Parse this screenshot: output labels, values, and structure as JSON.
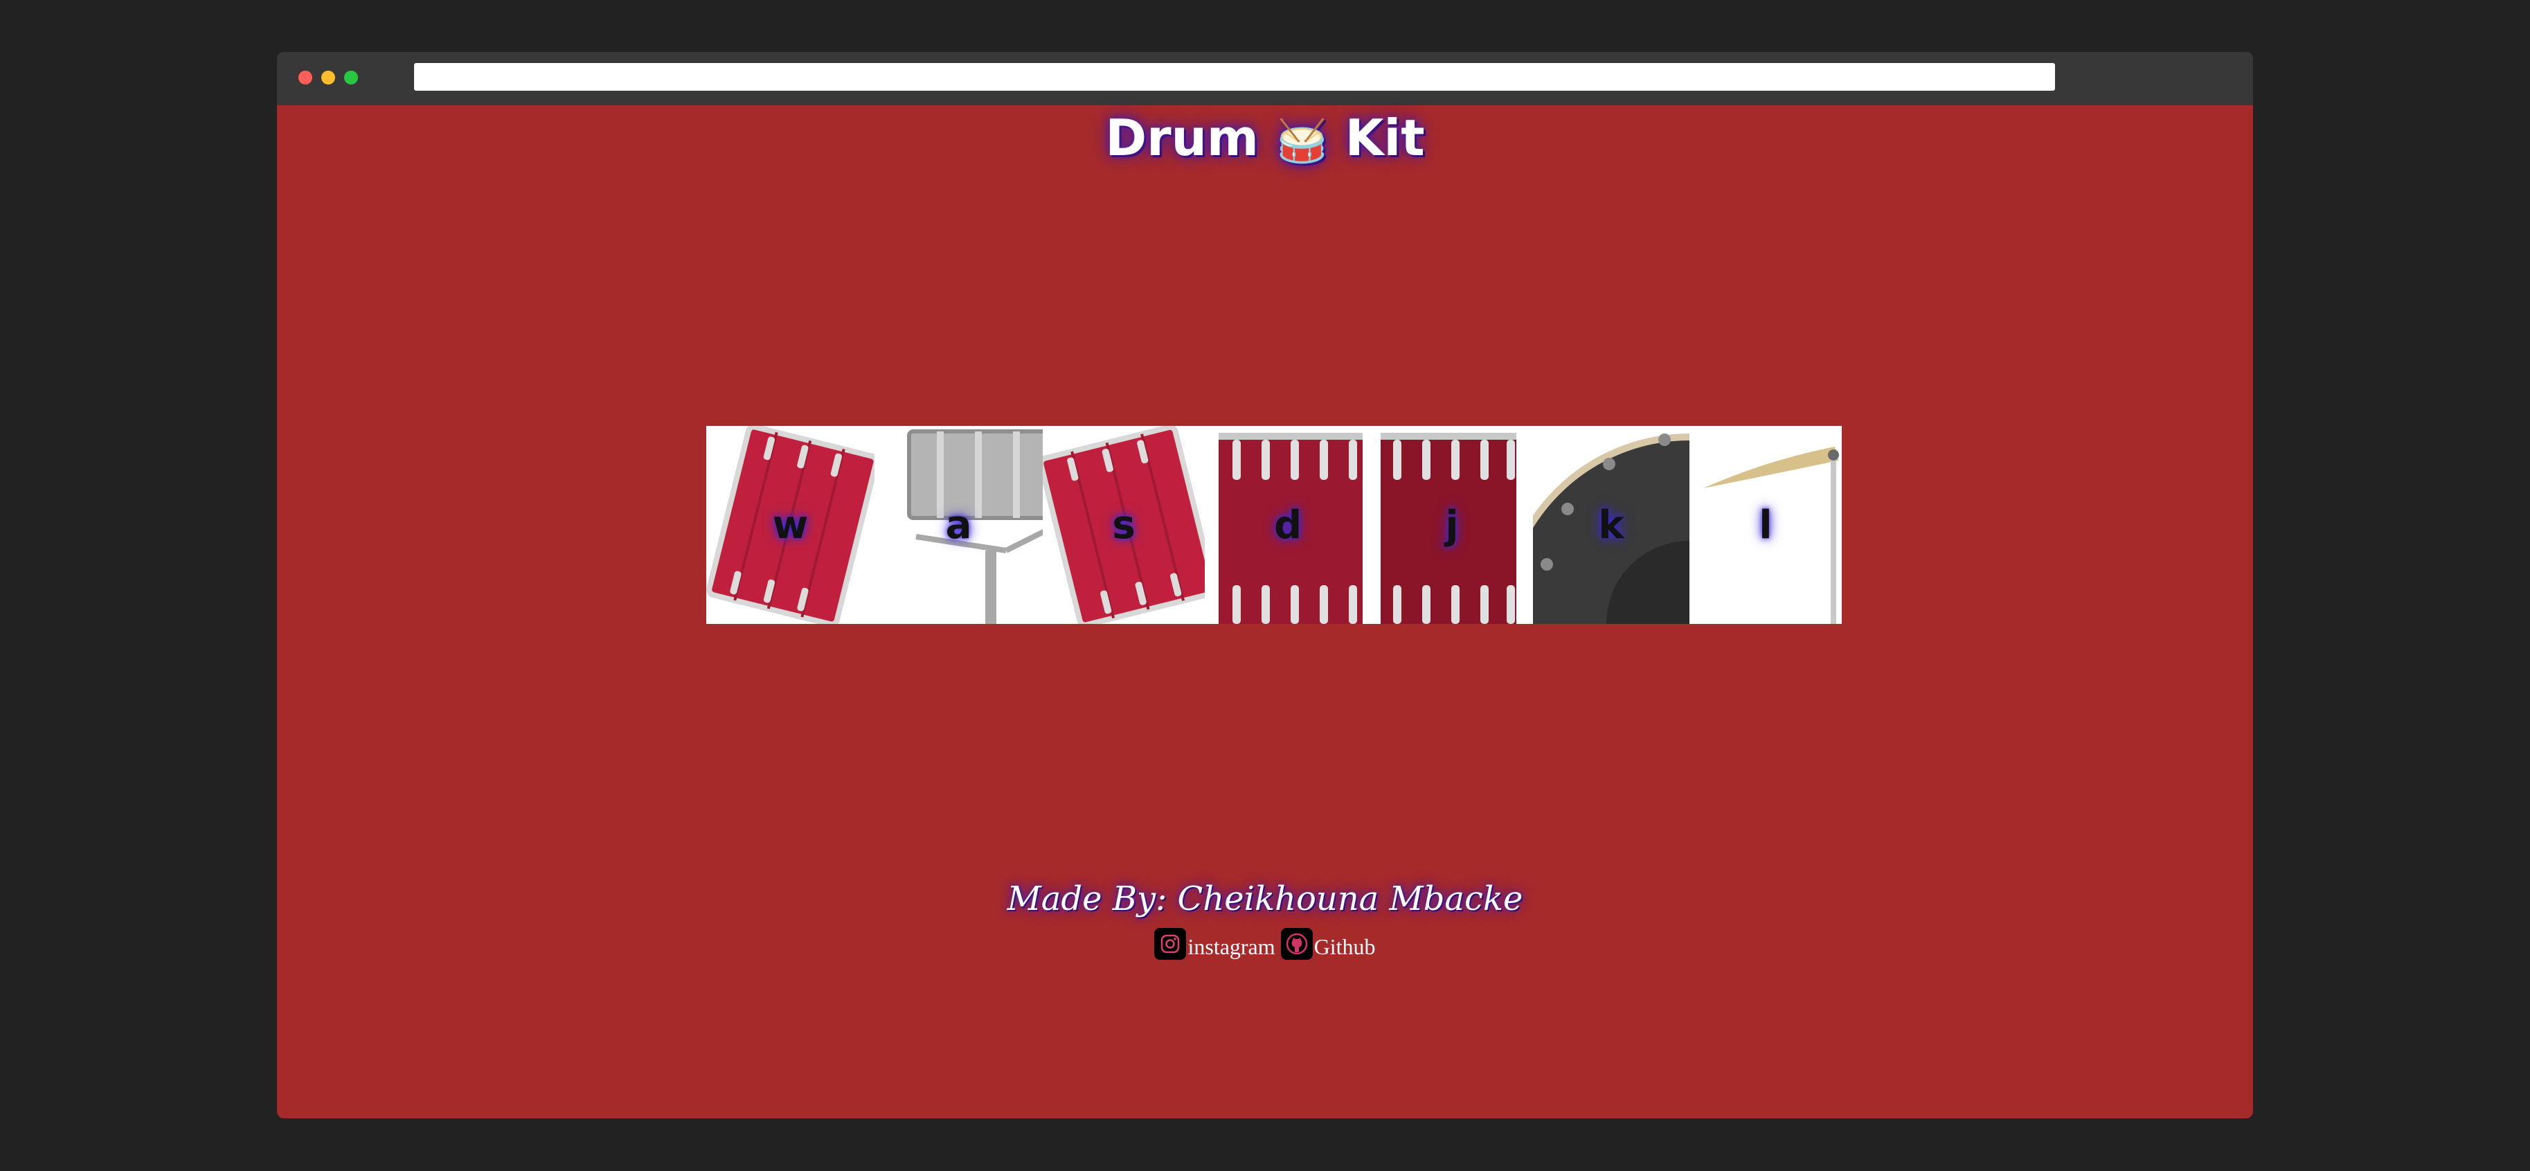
{
  "page": {
    "title_prefix": "Drum",
    "title_emoji": "🥁",
    "title_suffix": "Kit"
  },
  "drums": [
    {
      "key": "w",
      "icon": "tom-drum-icon"
    },
    {
      "key": "a",
      "icon": "snare-drum-icon"
    },
    {
      "key": "s",
      "icon": "tom-drum-icon"
    },
    {
      "key": "d",
      "icon": "floor-tom-icon"
    },
    {
      "key": "j",
      "icon": "floor-tom-icon"
    },
    {
      "key": "k",
      "icon": "bass-drum-icon"
    },
    {
      "key": "l",
      "icon": "cymbal-icon"
    }
  ],
  "footer": {
    "made_by": "Made By: Cheikhouna Mbacke",
    "links": [
      {
        "label": "instagram",
        "icon": "instagram-icon"
      },
      {
        "label": "Github",
        "icon": "github-icon"
      }
    ]
  },
  "colors": {
    "background": "#a72a2b",
    "page_backdrop": "#222222",
    "glow": "#4b1aa3",
    "drum_red": "#c0203d"
  }
}
